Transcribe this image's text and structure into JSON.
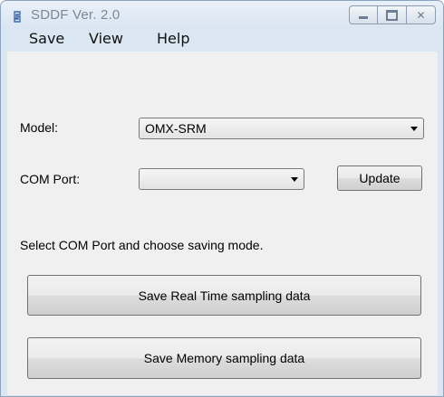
{
  "window": {
    "title": "SDDF Ver. 2.0"
  },
  "menu": {
    "items": [
      "Save",
      "View",
      "Help"
    ]
  },
  "form": {
    "model_label": "Model:",
    "model_value": "OMX-SRM",
    "com_port_label": "COM Port:",
    "com_port_value": "",
    "update_button": "Update",
    "instruction": "Select COM Port and choose saving mode."
  },
  "actions": {
    "save_realtime": "Save Real Time sampling data",
    "save_memory": "Save Memory sampling data"
  },
  "icons": {
    "app": "app-icon",
    "minimize": "minimize-icon",
    "maximize": "maximize-icon",
    "close": "close-icon",
    "dropdown": "chevron-down-icon"
  }
}
